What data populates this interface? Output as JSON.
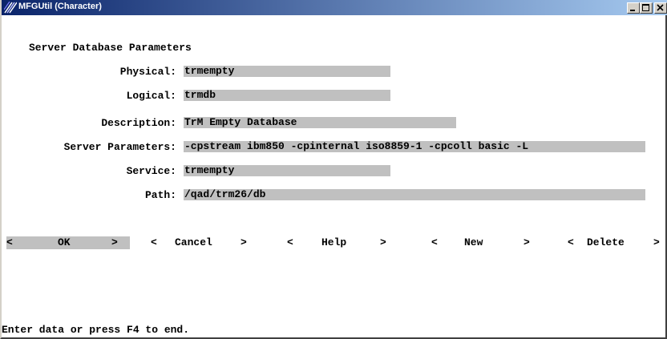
{
  "window": {
    "title": "MFGUtil (Character)",
    "icon": "mfg-app-icon"
  },
  "form": {
    "heading": "Server Database Parameters",
    "fields": [
      {
        "label": "Physical:",
        "value": "trmempty"
      },
      {
        "label": "Logical:",
        "value": "trmdb"
      },
      {
        "label": "Description:",
        "value": "TrM Empty Database"
      },
      {
        "label": "Server Parameters:",
        "value": "-cpstream ibm850 -cpinternal iso8859-1 -cpcoll basic -L"
      },
      {
        "label": "Service:",
        "value": "trmempty"
      },
      {
        "label": "Path:",
        "value": "/qad/trm26/db"
      }
    ]
  },
  "buttons": {
    "ok": {
      "open": "<",
      "label": "OK",
      "close": ">"
    },
    "cancel": {
      "open": "<",
      "label": "Cancel",
      "close": ">"
    },
    "help": {
      "open": "<",
      "label": "Help",
      "close": ">"
    },
    "new": {
      "open": "<",
      "label": "New",
      "close": ">"
    },
    "delete": {
      "open": "<",
      "label": "Delete",
      "close": ">"
    }
  },
  "status": {
    "message": "Enter data or press F4 to end."
  },
  "colors": {
    "titlebar_start": "#0a246a",
    "titlebar_end": "#a6caf0",
    "field_bg": "#c0c0c0"
  }
}
